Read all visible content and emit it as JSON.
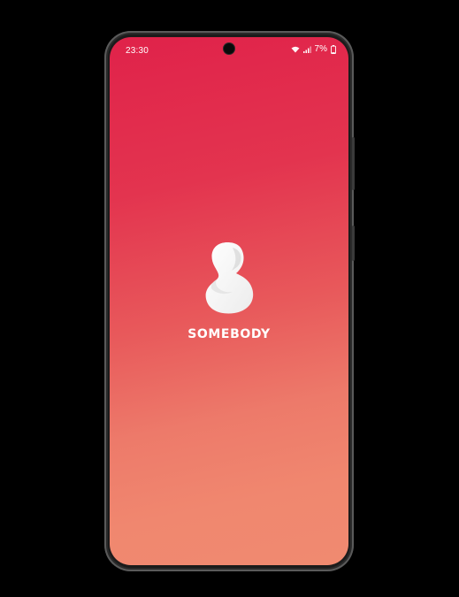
{
  "status_bar": {
    "time": "23:30",
    "battery_percent": "7%",
    "icons": [
      "wifi-icon",
      "signal-icon",
      "battery-icon"
    ]
  },
  "app": {
    "name": "SOMEBODY",
    "logo_icon": "somebody-logo"
  },
  "colors": {
    "gradient_top": "#e0224a",
    "gradient_bottom": "#f08a70",
    "text": "#ffffff"
  }
}
